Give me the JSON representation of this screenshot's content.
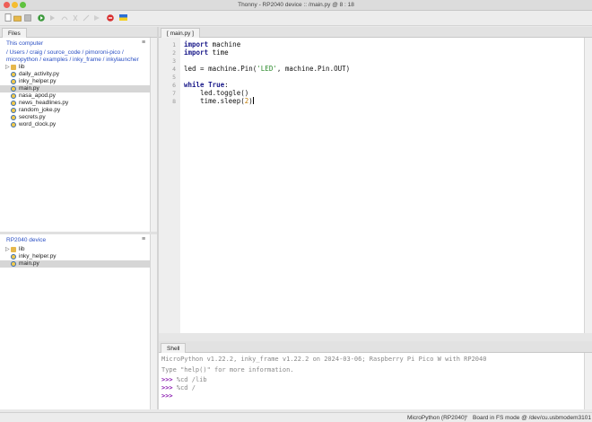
{
  "window": {
    "title": "Thonny  -  RP2040 device :: /main.py  @  8 : 18"
  },
  "toolbar": {
    "buttons": [
      {
        "name": "new-file",
        "icon": "new-file-icon"
      },
      {
        "name": "open-file",
        "icon": "folder-open-icon"
      },
      {
        "name": "save-file",
        "icon": "save-icon"
      },
      {
        "name": "run",
        "icon": "play-icon",
        "color": "#3c9a3c"
      },
      {
        "name": "debug",
        "icon": "debug-icon"
      },
      {
        "name": "step-over",
        "icon": "step-over-icon"
      },
      {
        "name": "step-into",
        "icon": "step-into-icon"
      },
      {
        "name": "step-out",
        "icon": "step-out-icon"
      },
      {
        "name": "resume",
        "icon": "resume-icon"
      },
      {
        "name": "stop",
        "icon": "stop-icon",
        "color": "#d83030"
      },
      {
        "name": "support-ukraine",
        "icon": "ukraine-flag-icon"
      }
    ]
  },
  "files_panel": {
    "tab_label": "Files",
    "computer_section": {
      "title": "This computer",
      "path": " / Users / craig / source_code / pimoroni-pico / micropython / examples / inky_frame / inkylauncher",
      "items": [
        {
          "label": "lib",
          "type": "folder",
          "expandable": true,
          "selected": false
        },
        {
          "label": "daily_activity.py",
          "type": "python",
          "selected": false
        },
        {
          "label": "inky_helper.py",
          "type": "python",
          "selected": false
        },
        {
          "label": "main.py",
          "type": "python",
          "selected": true
        },
        {
          "label": "nasa_apod.py",
          "type": "python",
          "selected": false
        },
        {
          "label": "news_headlines.py",
          "type": "python",
          "selected": false
        },
        {
          "label": "random_joke.py",
          "type": "python",
          "selected": false
        },
        {
          "label": "secrets.py",
          "type": "python",
          "selected": false
        },
        {
          "label": "word_clock.py",
          "type": "python",
          "selected": false
        }
      ]
    },
    "device_section": {
      "title": "RP2040 device",
      "items": [
        {
          "label": "lib",
          "type": "folder",
          "expandable": true,
          "selected": false
        },
        {
          "label": "inky_helper.py",
          "type": "python",
          "selected": false
        },
        {
          "label": "main.py",
          "type": "python",
          "selected": true
        }
      ]
    }
  },
  "editor": {
    "tab_label": "[ main.py ]",
    "cursor": {
      "line": 8,
      "column": 18
    },
    "lines": [
      {
        "n": "1",
        "code": "import machine"
      },
      {
        "n": "2",
        "code": "import time"
      },
      {
        "n": "3",
        "code": ""
      },
      {
        "n": "4",
        "code": "led = machine.Pin('LED', machine.Pin.OUT)"
      },
      {
        "n": "5",
        "code": ""
      },
      {
        "n": "6",
        "code": "while True:"
      },
      {
        "n": "7",
        "code": "    led.toggle()"
      },
      {
        "n": "8",
        "code": "    time.sleep(2)"
      }
    ]
  },
  "shell": {
    "tab_label": "Shell",
    "banner": "MicroPython v1.22.2, inky_frame v1.22.2 on 2024-03-06; Raspberry Pi Pico W with RP2040",
    "help_line": "Type \"help()\" for more information.",
    "prompt": ">>>",
    "history": [
      "%cd /lib",
      "%cd /"
    ]
  },
  "status": {
    "interpreter": "MicroPython (RP2040)",
    "separator": "•",
    "mode": "Board in FS mode @ /dev/cu.usbmodem3101"
  },
  "colors": {
    "accent_path": "#2a4fc4",
    "keyword": "#1a1a8a",
    "string": "#2a8a2a",
    "number": "#c07a00",
    "prompt": "#8a1ab0"
  }
}
